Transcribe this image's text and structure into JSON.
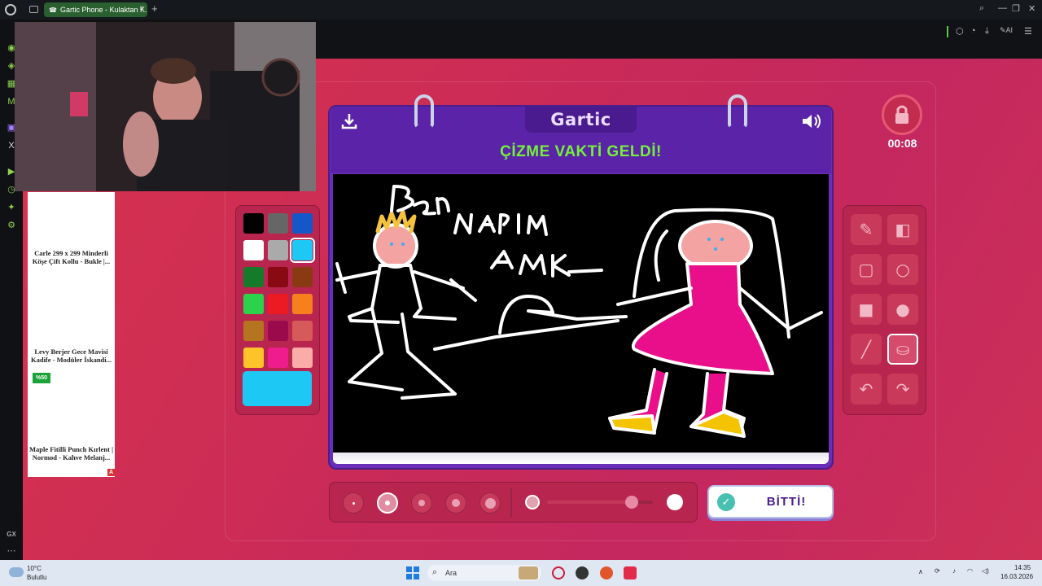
{
  "browser": {
    "tab_title": "Gartic Phone - Kulaktan K...",
    "tab_close": "×",
    "new_tab": "+",
    "toolbar_ai": "AI"
  },
  "ads": [
    {
      "title": "Carle 299 x 299 Minderli Köşe Çift Kollu - Bukle |..."
    },
    {
      "title": "Levy Berjer Gece Mavisi Kadife - Modüler İskandi...",
      "badge": "%50"
    },
    {
      "title": "Maple Fitilli Punch Kırlent | Normod - Kahve Melanj..."
    }
  ],
  "ad_marker": "A",
  "game": {
    "logo": "Gartic",
    "headline": "ÇİZME VAKTİ GELDİ!",
    "timer": "00:08",
    "finish_button": "BİTTİ!",
    "canvas_doodle_text": [
      "Ben",
      "NAPIM",
      "AMK"
    ]
  },
  "palette": {
    "colors": [
      "#000000",
      "#666666",
      "#1557c8",
      "#ffffff",
      "#aaaaaa",
      "#1ec8f5",
      "#157a2a",
      "#8a0a14",
      "#8a3a12",
      "#2bd24a",
      "#ec1a22",
      "#f7801e",
      "#b57420",
      "#9b0b4b",
      "#d65a5a",
      "#fec328",
      "#ee1c8c",
      "#fbaba8"
    ],
    "selected_index": 5,
    "current_color": "#1ec8f5"
  },
  "tools": [
    "pencil-icon",
    "eraser-icon",
    "rectangle-outline-icon",
    "ellipse-outline-icon",
    "rectangle-fill-icon",
    "ellipse-fill-icon",
    "line-icon",
    "bucket-icon",
    "undo-icon",
    "redo-icon"
  ],
  "selected_tool": "bucket-icon",
  "brush_sizes": {
    "count": 5,
    "selected_index": 1
  },
  "opacity_slider": {
    "value": 0.8
  },
  "taskbar": {
    "weather_temp": "10°C",
    "weather_desc": "Bulutlu",
    "search": "Ara",
    "time": "14:35",
    "date": "16.03.2026"
  },
  "sidebar_bottom": "GX"
}
